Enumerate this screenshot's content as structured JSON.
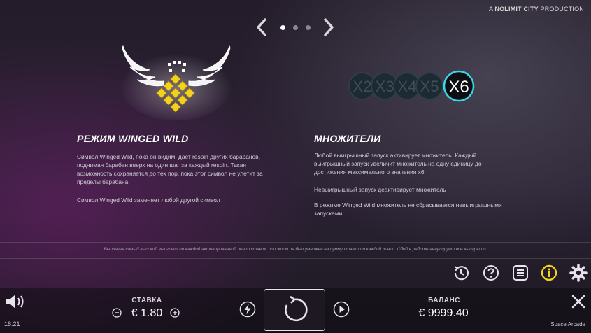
{
  "header": {
    "production_prefix": "A",
    "production_brand": "NOLIMIT CITY",
    "production_suffix": "PRODUCTION"
  },
  "pager": {
    "pages": 3,
    "active_index": 0
  },
  "winged_wild": {
    "title": "РЕЖИМ WINGED WILD",
    "paragraphs": [
      "Символ Winged Wild, пока он видим, дает respin других барабанов, поднимая барабан вверх на один шаг за каждый respin. Такая возможность сохраняется до тех пор, пока этот символ не улетит за пределы барабана",
      "Символ Winged Wild заменяет любой другой символ"
    ]
  },
  "multipliers": {
    "title": "МНОЖИТЕЛИ",
    "labels": [
      "X2",
      "X3",
      "X4",
      "X5",
      "X6"
    ],
    "paragraphs": [
      "Любой выигрышный запуск активирует множитель. Каждый выигрышный запуск увеличит множитель на одну единицу до достижения максимального значения x6",
      "Невыигрышный запуск деактивирует множитель",
      "В режиме Winged Wild множитель не сбрасывается невыигрышными запусками"
    ]
  },
  "disclaimer": "Выплачен самый высокий выигрыш по каждой активированной линии ставок, при этом он был умножен на сумму ставки по каждой линии. Сбой в работе аннулирует все выигрыши.",
  "toolbar": {
    "icons": [
      "history-icon",
      "help-icon",
      "paytable-icon",
      "info-icon",
      "settings-icon"
    ],
    "active": "info-icon"
  },
  "bottom": {
    "time": "18:21",
    "bet_label": "СТАВКА",
    "bet_value": "€ 1.80",
    "balance_label": "БАЛАНС",
    "balance_value": "€ 9999.40",
    "game_name": "Space Arcade"
  },
  "colors": {
    "accent_yellow": "#f2d21a",
    "panel_border": "#e8e6ee"
  }
}
